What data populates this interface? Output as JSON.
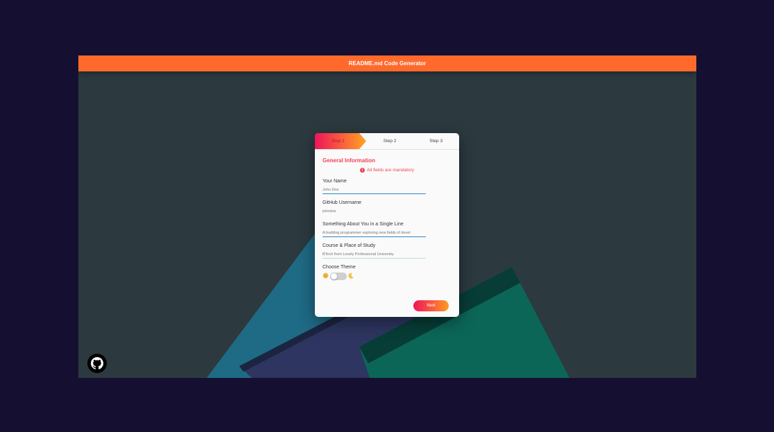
{
  "header": {
    "title": "README.md Code Generator"
  },
  "steps": [
    {
      "label": "Step 1"
    },
    {
      "label": "Step 2"
    },
    {
      "label": "Step 3"
    }
  ],
  "form": {
    "section_title": "General Information",
    "notice": "All fields are mandatory",
    "fields": [
      {
        "label": "Your Name",
        "value": "",
        "placeholder": "John Doe"
      },
      {
        "label": "GitHub Username",
        "value": "",
        "placeholder": "johndoe"
      },
      {
        "label": "Something About You in a Single Line",
        "value": "",
        "placeholder": "A budding programmer exploring new fields of devel"
      },
      {
        "label": "Course & Place of Study",
        "value": "",
        "placeholder": "BTech from Lovely Professional University"
      }
    ],
    "theme_label": "Choose Theme",
    "theme_light_icon": "sun-face-icon",
    "theme_dark_icon": "moon-icon",
    "next_label": "Next"
  },
  "colors": {
    "accent": "#ff6a2c",
    "gradient_start": "#f0145a",
    "gradient_end": "#ffa323",
    "page_bg": "#150f31"
  }
}
